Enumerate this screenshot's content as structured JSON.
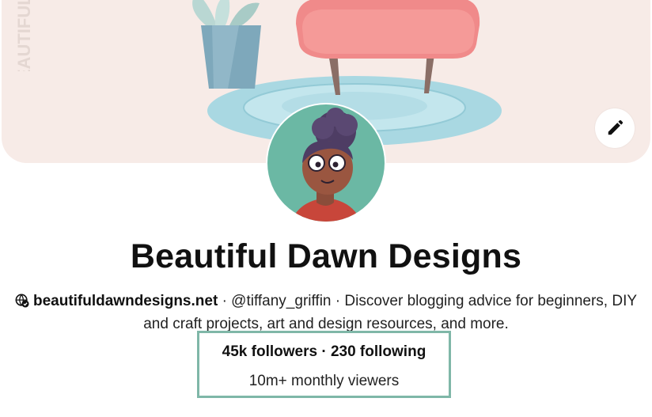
{
  "profile": {
    "name": "Beautiful Dawn Designs",
    "website": "beautifuldawndesigns.net",
    "separator": "·",
    "handle": "@tiffany_griffin",
    "description_line1": "Discover blogging advice for beginners, DIY",
    "description_line2": "and craft projects, art and design resources, and more."
  },
  "cover": {
    "watermark_text": "BEAUTIFULD",
    "edit_icon": "pencil-icon"
  },
  "stats": {
    "followers": "45k followers",
    "separator": "·",
    "following": "230 following",
    "monthly_viewers": "10m+ monthly viewers"
  },
  "colors": {
    "cover_bg": "#f7ebe7",
    "highlight_border": "#7fb7a8",
    "chair_seat": "#f08a8a",
    "rug": "#a9d8e2",
    "avatar_bg": "#6bb8a4"
  }
}
